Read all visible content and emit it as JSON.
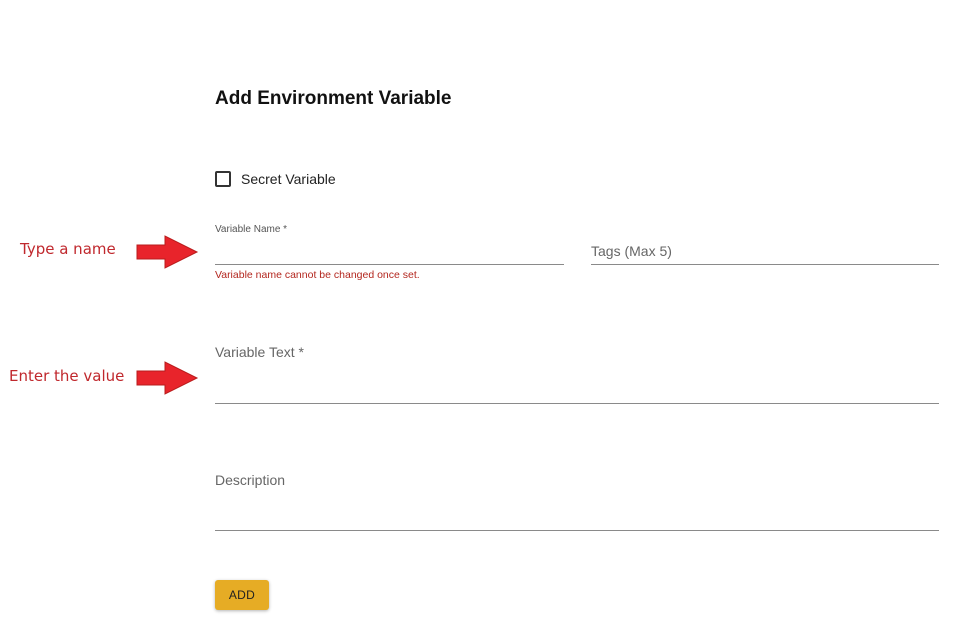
{
  "form": {
    "title": "Add Environment Variable",
    "secret_checkbox": {
      "label": "Secret Variable",
      "checked": false
    },
    "variable_name": {
      "label": "Variable Name *",
      "value": "",
      "hint": "Variable name cannot be changed once set."
    },
    "tags": {
      "placeholder": "Tags (Max 5)",
      "value": ""
    },
    "variable_text": {
      "placeholder": "Variable Text *",
      "value": ""
    },
    "description": {
      "placeholder": "Description",
      "value": ""
    },
    "add_button": {
      "label": "ADD",
      "color": "#e6ac25"
    }
  },
  "annotations": [
    {
      "text": "Type a name",
      "icon": "right-arrow-icon",
      "color": "#e8242b"
    },
    {
      "text": "Enter the value",
      "icon": "right-arrow-icon",
      "color": "#e8242b"
    }
  ],
  "colors": {
    "error_text": "#b3261e",
    "annotation_text": "#c0282d"
  }
}
